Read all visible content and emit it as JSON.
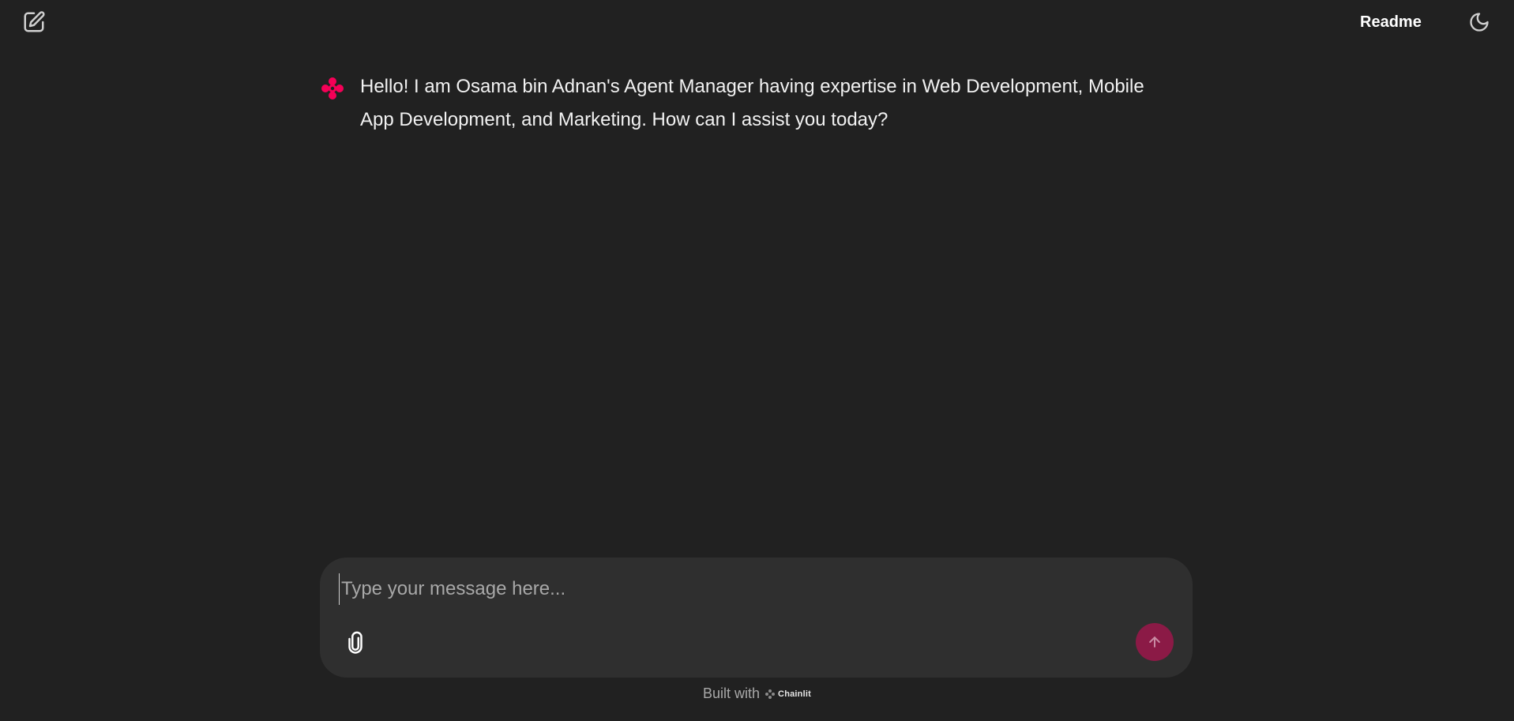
{
  "header": {
    "new_chat_icon": "edit-square-icon",
    "readme_label": "Readme",
    "theme_icon": "moon-icon"
  },
  "messages": [
    {
      "author_icon": "chainlit-logo-icon",
      "text": "Hello! I am Osama bin Adnan's Agent Manager having expertise in Web Development, Mobile App Development, and Marketing. How can I assist you today?"
    }
  ],
  "composer": {
    "placeholder": "Type your message here...",
    "value": "",
    "attach_icon": "paperclip-icon",
    "send_icon": "arrow-up-icon"
  },
  "footer": {
    "built_with": "Built with",
    "brand": "Chainlit"
  },
  "colors": {
    "background": "#212121",
    "composer_bg": "#2f2f2f",
    "accent": "#f50057",
    "send_button": "#8b1a46"
  }
}
